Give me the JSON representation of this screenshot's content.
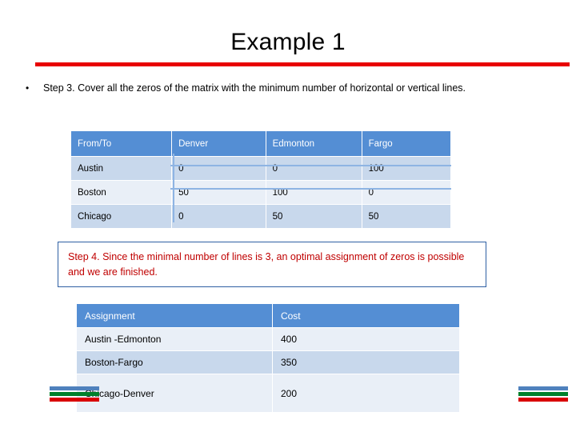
{
  "slide": {
    "title": "Example 1",
    "bullet_marker": "•",
    "step3_text": "Step 3. Cover all the zeros of the matrix with the minimum number of horizontal or vertical lines.",
    "step4_text": "Step 4. Since the minimal number of lines is 3, an optimal assignment of zeros is possible and we are finished.",
    "accent_colors": {
      "title_rule": "#e80000",
      "table_header": "#548ed4",
      "callout_border": "#2e5fa3",
      "callout_text": "#c00000",
      "cover_line": "#8eb4e3"
    }
  },
  "matrix_table": {
    "headers": [
      "From/To",
      "Denver",
      "Edmonton",
      "Fargo"
    ],
    "rows": [
      [
        "Austin",
        "0",
        "0",
        "100"
      ],
      [
        "Boston",
        "50",
        "100",
        "0"
      ],
      [
        "Chicago",
        "0",
        "50",
        "50"
      ]
    ]
  },
  "assignment_table": {
    "headers": [
      "Assignment",
      "Cost"
    ],
    "rows": [
      [
        "Austin -Edmonton",
        "400"
      ],
      [
        "Boston-Fargo",
        "350"
      ],
      [
        "Chicago-Denver",
        "200"
      ]
    ]
  }
}
